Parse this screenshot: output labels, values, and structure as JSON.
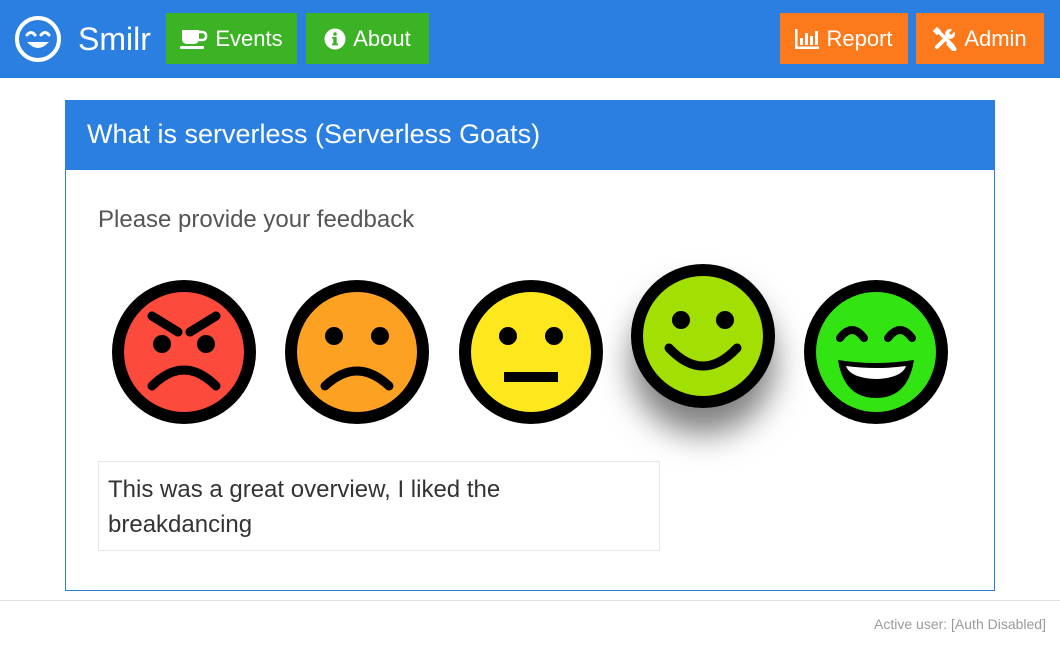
{
  "colors": {
    "brand": "#2a7fe1",
    "nav_green": "#3cb325",
    "nav_orange": "#fd7a1c"
  },
  "navbar": {
    "logo_icon": "smiley-face-icon",
    "brand": "Smilr",
    "left_buttons": [
      {
        "label": "Events",
        "icon": "coffee-cup-icon"
      },
      {
        "label": "About",
        "icon": "info-circle-icon"
      }
    ],
    "right_buttons": [
      {
        "label": "Report",
        "icon": "bar-chart-icon"
      },
      {
        "label": "Admin",
        "icon": "tools-icon"
      }
    ]
  },
  "panel": {
    "title": "What is serverless (Serverless Goats)",
    "prompt": "Please provide your feedback",
    "rating_scale": 5,
    "selected_rating": 4,
    "faces": [
      {
        "rating": 1,
        "mood": "angry",
        "icon": "angry-face-icon",
        "color": "#fc4a3d"
      },
      {
        "rating": 2,
        "mood": "sad",
        "icon": "sad-face-icon",
        "color": "#fca121"
      },
      {
        "rating": 3,
        "mood": "neutral",
        "icon": "neutral-face-icon",
        "color": "#fde81e"
      },
      {
        "rating": 4,
        "mood": "happy",
        "icon": "happy-face-icon",
        "color": "#a2df02"
      },
      {
        "rating": 5,
        "mood": "very-happy",
        "icon": "laughing-face-icon",
        "color": "#33e413"
      }
    ],
    "comment": "This was a great overview, I liked the breakdancing"
  },
  "footer": {
    "active_user": "Active user: [Auth Disabled]"
  }
}
